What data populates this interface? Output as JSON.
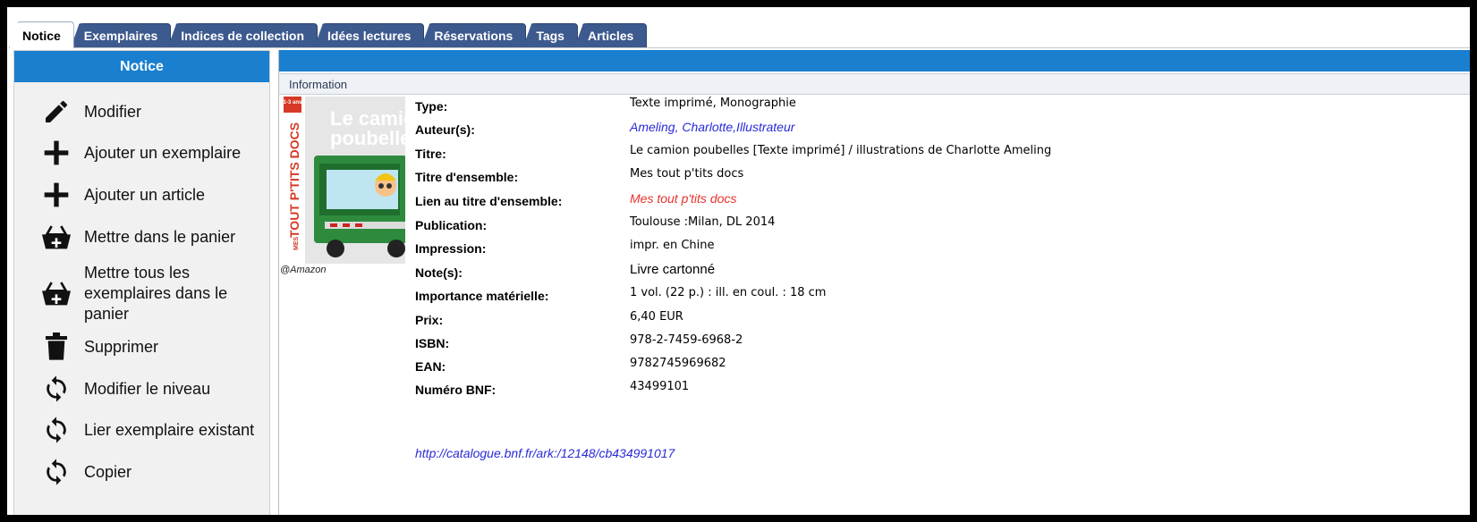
{
  "tabs": [
    {
      "label": "Notice",
      "active": true
    },
    {
      "label": "Exemplaires",
      "active": false
    },
    {
      "label": "Indices de collection",
      "active": false
    },
    {
      "label": "Idées lectures",
      "active": false
    },
    {
      "label": "Réservations",
      "active": false
    },
    {
      "label": "Tags",
      "active": false
    },
    {
      "label": "Articles",
      "active": false
    }
  ],
  "sidebar": {
    "title": "Notice",
    "items": [
      {
        "label": "Modifier",
        "icon": "pencil-icon"
      },
      {
        "label": "Ajouter un exemplaire",
        "icon": "plus-icon"
      },
      {
        "label": "Ajouter un article",
        "icon": "plus-icon"
      },
      {
        "label": "Mettre dans le panier",
        "icon": "basket-add-icon"
      },
      {
        "label": "Mettre tous les exemplaires dans le panier",
        "icon": "basket-add-icon"
      },
      {
        "label": "Supprimer",
        "icon": "trash-icon"
      },
      {
        "label": "Modifier le niveau",
        "icon": "refresh-icon"
      },
      {
        "label": "Lier exemplaire existant",
        "icon": "refresh-icon"
      },
      {
        "label": "Copier",
        "icon": "refresh-icon"
      }
    ]
  },
  "main": {
    "info_title": "Information",
    "cover": {
      "title_line1": "Le camio",
      "title_line2": "poubelle",
      "series_small": "MES",
      "series_big": "TOUT P'TITS DOCS",
      "age": "1-3 ans",
      "credit": "@Amazon"
    },
    "fields": [
      {
        "label": "Type:",
        "value": "Texte imprimé, Monographie",
        "style": "normal"
      },
      {
        "label": "Auteur(s):",
        "value": "Ameling, Charlotte,Illustrateur",
        "style": "link"
      },
      {
        "label": "Titre:",
        "value": "Le camion poubelles [Texte imprimé] / illustrations de Charlotte Ameling",
        "style": "normal"
      },
      {
        "label": "Titre d'ensemble:",
        "value": "Mes tout p'tits docs",
        "style": "normal"
      },
      {
        "label": "Lien au titre d'ensemble:",
        "value": "Mes tout p'tits docs",
        "style": "link-red"
      },
      {
        "label": "Publication:",
        "value": "Toulouse :Milan, DL 2014",
        "style": "normal"
      },
      {
        "label": "Impression:",
        "value": "impr. en Chine",
        "style": "normal"
      },
      {
        "label": "Note(s):",
        "value": "Livre cartonné",
        "style": "plain"
      },
      {
        "label": "Importance matérielle:",
        "value": "1 vol. (22 p.) : ill. en coul. : 18 cm",
        "style": "normal"
      },
      {
        "label": "Prix:",
        "value": "6,40 EUR",
        "style": "normal"
      },
      {
        "label": "ISBN:",
        "value": "978-2-7459-6968-2",
        "style": "normal"
      },
      {
        "label": "EAN:",
        "value": "9782745969682",
        "style": "normal"
      },
      {
        "label": "Numéro BNF:",
        "value": "43499101",
        "style": "normal"
      }
    ],
    "bnf_link": "http://catalogue.bnf.fr/ark:/12148/cb434991017"
  },
  "colors": {
    "accent": "#1a7fcf",
    "tab_inactive": "#3d5a8e",
    "link": "#2a2ad8",
    "link_red": "#e8312a"
  }
}
